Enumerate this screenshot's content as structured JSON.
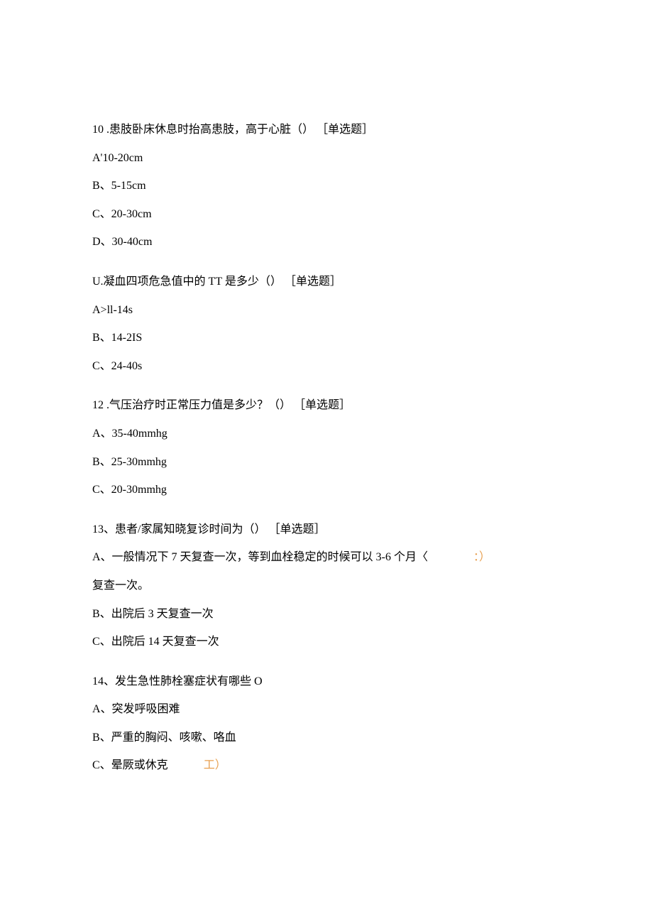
{
  "questions": [
    {
      "number": "10",
      "text": " .患肢卧床休息时抬高患肢，高于心脏（） ［单选题］",
      "options": [
        "A'10-20cm",
        "B、5-15cm",
        "C、20-30cm",
        "D、30-40cm"
      ]
    },
    {
      "number": "",
      "text": "U.凝血四项危急值中的 TT 是多少（） ［单选题］",
      "options": [
        "A>ll-14s",
        "B、14-2IS",
        "C、24-40s"
      ]
    },
    {
      "number": "12",
      "text": " .气压治疗时正常压力值是多少？（） ［单选题］",
      "options": [
        "A、35-40mmhg",
        "B、25-30mmhg",
        "C、20-30mmhg"
      ]
    },
    {
      "number": "13",
      "text": "、患者/家属知晓复诊时间为（） ［单选题］",
      "line_a_part1": "A、一般情况下 7 天复查一次，等到血栓稳定的时候可以 3-6 个月〈",
      "line_a_orange": "    ：）",
      "line_a_part2": "复查一次。",
      "options_rest": [
        "B、出院后 3 天复查一次",
        "C、出院后 14 天复查一次"
      ]
    },
    {
      "number": "14",
      "text": "、发生急性肺栓塞症状有哪些 O",
      "options": [
        "A、突发呼吸困难",
        "B、严重的胸闷、咳嗽、咯血"
      ],
      "option_c_part1": "C、晕厥或休克",
      "option_c_orange": "工）"
    }
  ]
}
